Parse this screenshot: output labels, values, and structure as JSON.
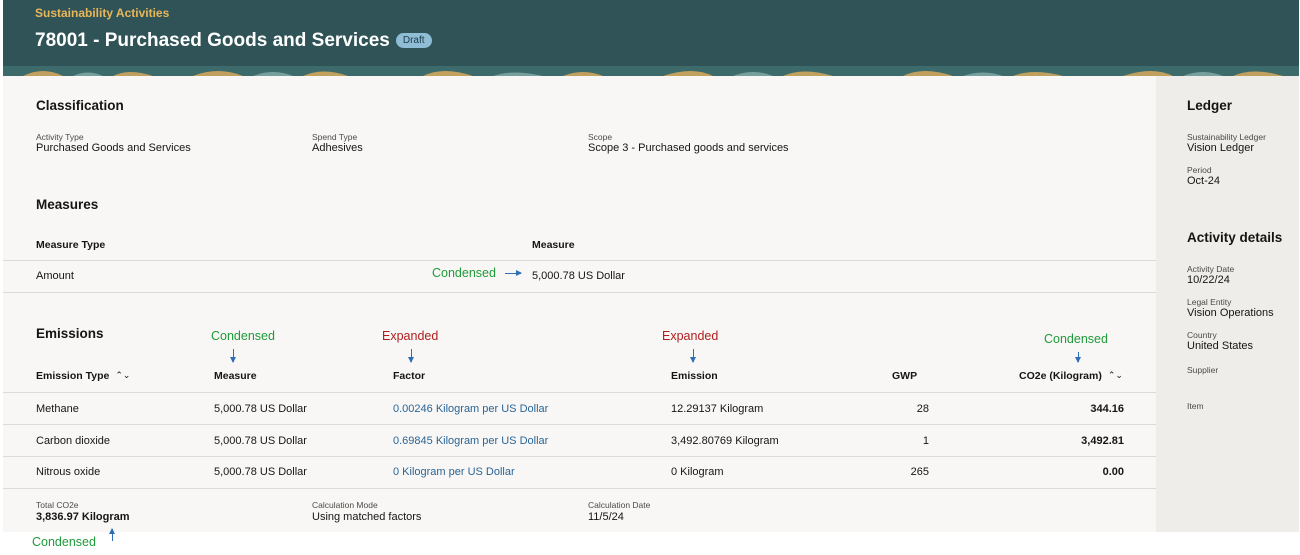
{
  "header": {
    "breadcrumb": "Sustainability Activities",
    "title": "78001 - Purchased Goods and Services",
    "status_badge": "Draft"
  },
  "classification": {
    "heading": "Classification",
    "activity_type_label": "Activity Type",
    "activity_type_value": "Purchased Goods and Services",
    "spend_type_label": "Spend Type",
    "spend_type_value": "Adhesives",
    "scope_label": "Scope",
    "scope_value": "Scope 3 - Purchased goods and services"
  },
  "measures": {
    "heading": "Measures",
    "columns": {
      "measure_type": "Measure Type",
      "measure": "Measure"
    },
    "rows": [
      {
        "type": "Amount",
        "value": "5,000.78 US Dollar"
      }
    ]
  },
  "emissions": {
    "heading": "Emissions",
    "columns": {
      "emission_type": "Emission Type",
      "measure": "Measure",
      "factor": "Factor",
      "emission": "Emission",
      "gwp": "GWP",
      "co2e": "CO2e (Kilogram)"
    },
    "rows": [
      {
        "type": "Methane",
        "measure": "5,000.78 US Dollar",
        "factor": "0.00246 Kilogram per US Dollar",
        "emission": "12.29137 Kilogram",
        "gwp": "28",
        "co2e": "344.16"
      },
      {
        "type": "Carbon dioxide",
        "measure": "5,000.78 US Dollar",
        "factor": "0.69845 Kilogram per US Dollar",
        "emission": "3,492.80769 Kilogram",
        "gwp": "1",
        "co2e": "3,492.81"
      },
      {
        "type": "Nitrous oxide",
        "measure": "5,000.78 US Dollar",
        "factor": "0 Kilogram per US Dollar",
        "emission": "0 Kilogram",
        "gwp": "265",
        "co2e": "0.00"
      }
    ],
    "summary": {
      "total_label": "Total CO2e",
      "total_value": "3,836.97 Kilogram",
      "mode_label": "Calculation Mode",
      "mode_value": "Using matched factors",
      "date_label": "Calculation Date",
      "date_value": "11/5/24"
    }
  },
  "ledger": {
    "heading": "Ledger",
    "sust_ledger_label": "Sustainability Ledger",
    "sust_ledger_value": "Vision Ledger",
    "period_label": "Period",
    "period_value": "Oct-24"
  },
  "activity_details": {
    "heading": "Activity details",
    "date_label": "Activity Date",
    "date_value": "10/22/24",
    "legal_entity_label": "Legal Entity",
    "legal_entity_value": "Vision Operations",
    "country_label": "Country",
    "country_value": "United States",
    "supplier_label": "Supplier",
    "item_label": "Item"
  },
  "annotations": {
    "condensed": "Condensed",
    "expanded": "Expanded"
  },
  "colors": {
    "header_bg": "#2f5356",
    "breadcrumb": "#e8b75a",
    "link": "#2a6496",
    "condensed_annotation": "#1f9a3a",
    "expanded_annotation": "#b01e1e",
    "annotation_arrow": "#2f6fb7"
  }
}
